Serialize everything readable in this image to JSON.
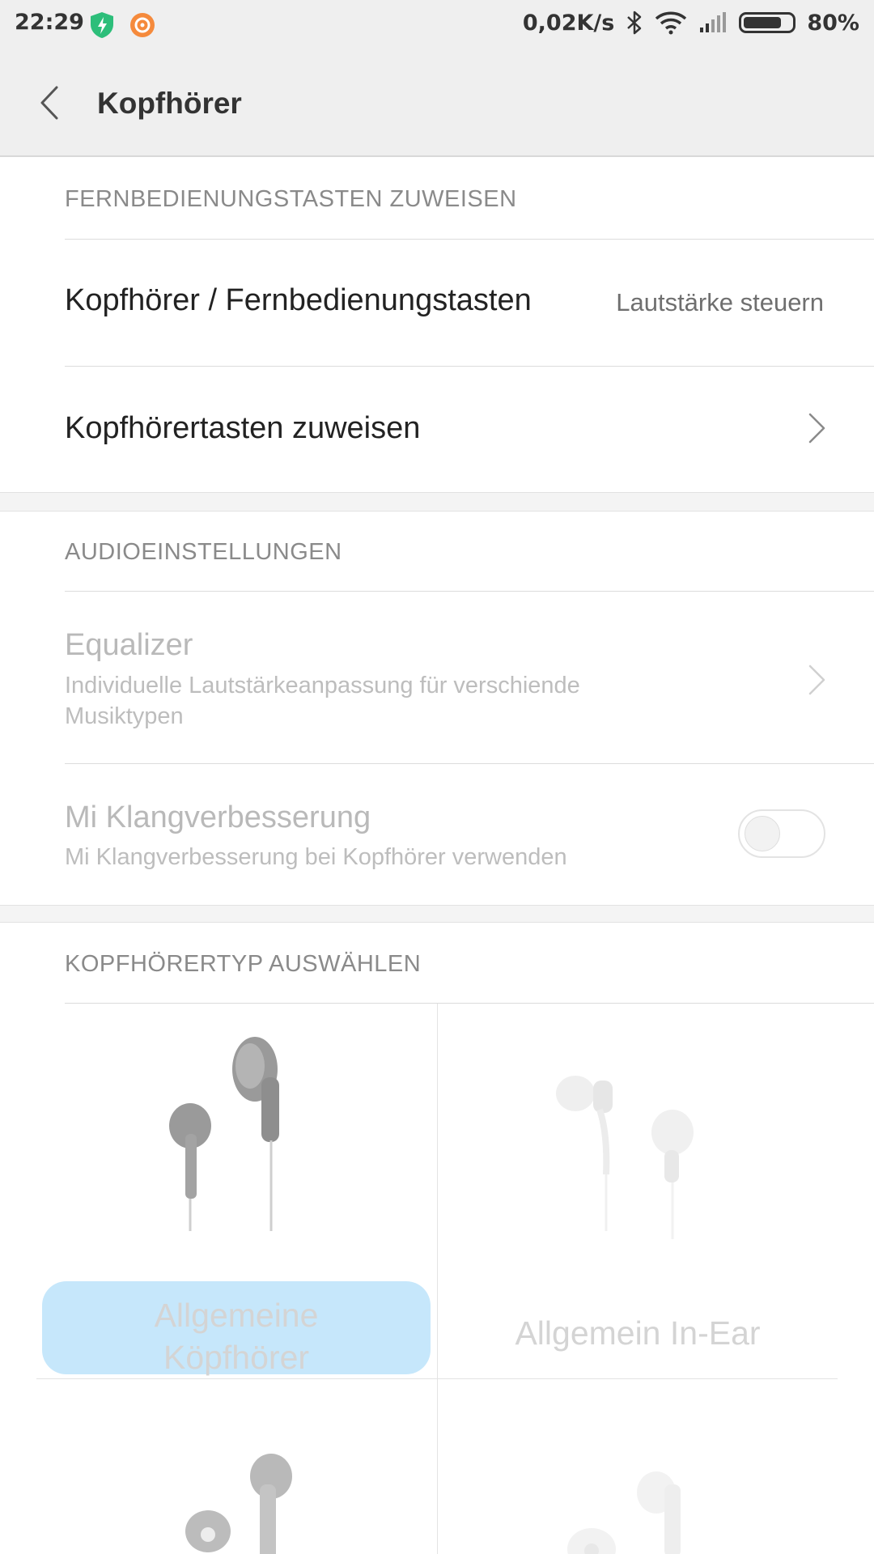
{
  "status_bar": {
    "time": "22:29",
    "net_speed": "0,02K/s",
    "battery": "80%",
    "battery_level": 0.8,
    "icons": [
      "shield-icon",
      "app-icon",
      "bluetooth-icon",
      "wifi-icon",
      "signal-icon",
      "battery-icon"
    ]
  },
  "app_bar": {
    "title": "Kopfhörer",
    "back_icon": "chevron-left-icon"
  },
  "section_remote": {
    "header": "FERNBEDIENUNGSTASTEN ZUWEISEN",
    "row1": {
      "title": "Kopfhörer / Fernbedienungstasten",
      "value": "Lautstärke steuern"
    },
    "row2": {
      "title": "Kopfhörertasten zuweisen"
    }
  },
  "section_audio": {
    "header": "AUDIOEINSTELLUNGEN",
    "equalizer": {
      "title": "Equalizer",
      "subtitle_line1": "Individuelle Lautstärkeanpassung für verschiende",
      "subtitle_line2": "Musiktypen"
    },
    "mi_sound": {
      "title": "Mi Klangverbesserung",
      "subtitle": "Mi Klangverbesserung bei Kopfhörer verwenden",
      "enabled": false
    }
  },
  "section_type": {
    "header": "KOPFHÖRERTYP AUSWÄHLEN",
    "items": [
      {
        "label_line1": "Allgemeine",
        "label_line2": "Köpfhörer",
        "selected": true
      },
      {
        "label": "Allgemein In-Ear",
        "selected": false
      }
    ]
  },
  "colors": {
    "selection": "#c6e7fb",
    "header_bg": "#efefef",
    "shield_green": "#2dbe7a",
    "app_orange": "#f58a3c"
  }
}
